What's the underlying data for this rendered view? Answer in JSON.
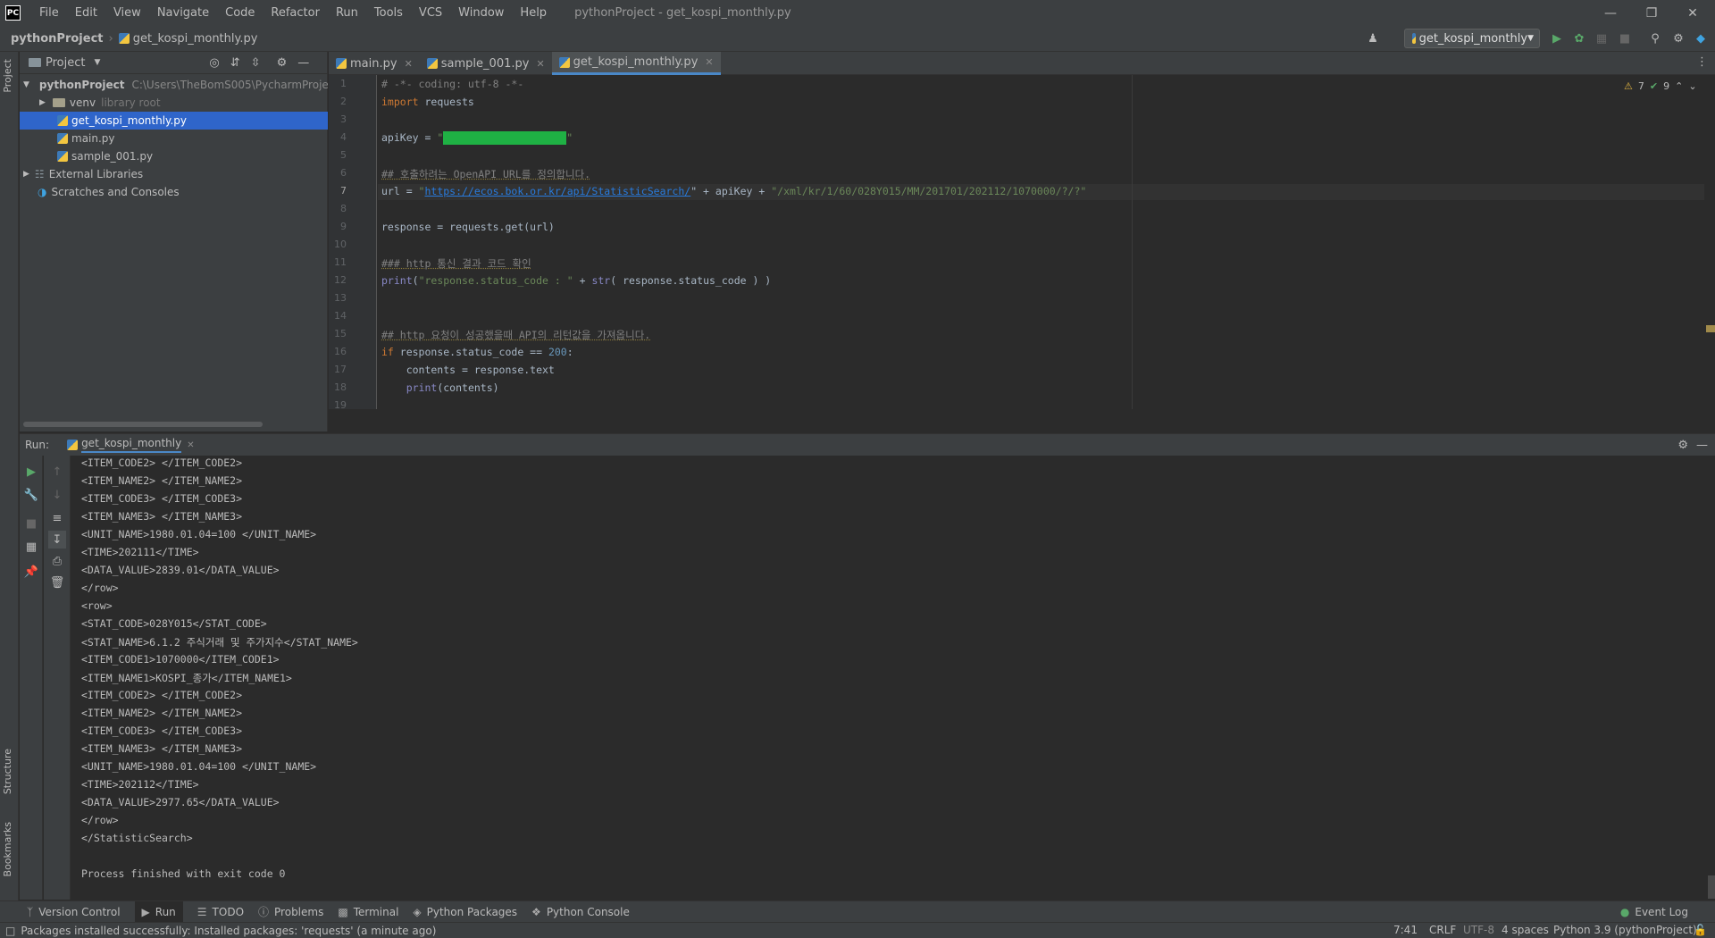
{
  "app": {
    "logo": "PC",
    "menu": [
      "File",
      "Edit",
      "View",
      "Navigate",
      "Code",
      "Refactor",
      "Run",
      "Tools",
      "VCS",
      "Window",
      "Help"
    ],
    "window_title": "pythonProject - get_kospi_monthly.py"
  },
  "nav": {
    "project": "pythonProject",
    "file": "get_kospi_monthly.py",
    "run_config": "get_kospi_monthly"
  },
  "project_panel": {
    "title": "Project",
    "root": "pythonProject",
    "root_path": "C:\\Users\\TheBomS005\\PycharmProjec",
    "venv": "venv",
    "venv_hint": "library root",
    "files": [
      "get_kospi_monthly.py",
      "main.py",
      "sample_001.py"
    ],
    "external": "External Libraries",
    "scratches": "Scratches and Consoles"
  },
  "left_strip": {
    "project": "Project",
    "structure": "Structure",
    "bookmarks": "Bookmarks"
  },
  "editor": {
    "tabs": [
      "main.py",
      "sample_001.py",
      "get_kospi_monthly.py"
    ],
    "line_numbers": [
      "1",
      "2",
      "3",
      "4",
      "5",
      "6",
      "7",
      "8",
      "9",
      "10",
      "11",
      "12",
      "13",
      "14",
      "15",
      "16",
      "17",
      "18",
      "19"
    ],
    "inspection_warnings": "7",
    "inspection_ok": "9",
    "code": {
      "l1": "# -*- coding: utf-8 -*-",
      "l2_kw": "import",
      "l2_rest": " requests",
      "l4_a": "apiKey = ",
      "l4_q1": "\"",
      "l4_q2": "\"",
      "l6": "## 호출하려는 OpenAPI URL를 정의합니다.",
      "l7_a": "url = ",
      "l7_q": "\"",
      "l7_link": "https://ecos.bok.or.kr/api/StatisticSearch/",
      "l7_b": "\" + apiKey + ",
      "l7_str": "\"/xml/kr/1/60/028Y015/MM/201701/202112/1070000/?/?\"",
      "l9": "response = requests.get(url)",
      "l11": "### http 통신 결과 코드 확인",
      "l12_fn": "print",
      "l12_a": "(",
      "l12_str": "\"response.status_code : \"",
      "l12_b": " + ",
      "l12_fn2": "str",
      "l12_c": "( response.status_code ) )",
      "l14": "## http 요청이 성공했을때 API의 리턴값을 가져옵니다.",
      "l15_kw": "if",
      "l15_a": " response.status_code == ",
      "l15_num": "200",
      "l15_b": ":",
      "l16": "    contents = response.text",
      "l17_pad": "    ",
      "l17_fn": "print",
      "l17_rest": "(contents)"
    }
  },
  "run": {
    "label": "Run:",
    "tab": "get_kospi_monthly",
    "output": [
      "<ITEM_CODE2> </ITEM_CODE2>",
      "<ITEM_NAME2> </ITEM_NAME2>",
      "<ITEM_CODE3> </ITEM_CODE3>",
      "<ITEM_NAME3> </ITEM_NAME3>",
      "<UNIT_NAME>1980.01.04=100 </UNIT_NAME>",
      "<TIME>202111</TIME>",
      "<DATA_VALUE>2839.01</DATA_VALUE>",
      "</row>",
      "<row>",
      "<STAT_CODE>028Y015</STAT_CODE>",
      "<STAT_NAME>6.1.2 주식거래 및 주가지수</STAT_NAME>",
      "<ITEM_CODE1>1070000</ITEM_CODE1>",
      "<ITEM_NAME1>KOSPI_종가</ITEM_NAME1>",
      "<ITEM_CODE2> </ITEM_CODE2>",
      "<ITEM_NAME2> </ITEM_NAME2>",
      "<ITEM_CODE3> </ITEM_CODE3>",
      "<ITEM_NAME3> </ITEM_NAME3>",
      "<UNIT_NAME>1980.01.04=100 </UNIT_NAME>",
      "<TIME>202112</TIME>",
      "<DATA_VALUE>2977.65</DATA_VALUE>",
      "</row>",
      "</StatisticSearch>",
      "",
      "Process finished with exit code 0"
    ]
  },
  "toolwindows": [
    "Version Control",
    "Run",
    "TODO",
    "Problems",
    "Terminal",
    "Python Packages",
    "Python Console"
  ],
  "event_log": "Event Log",
  "status": {
    "message": "Packages installed successfully: Installed packages: 'requests' (a minute ago)",
    "position": "7:41",
    "line_sep": "CRLF",
    "encoding": "UTF-8",
    "indent": "4 spaces",
    "interpreter": "Python 3.9 (pythonProject)"
  },
  "colors": {
    "accent": "#2f65ca",
    "run_green": "#59a869",
    "redaction": "#1fb144",
    "keyword": "#cc7832",
    "string": "#6a8759"
  }
}
